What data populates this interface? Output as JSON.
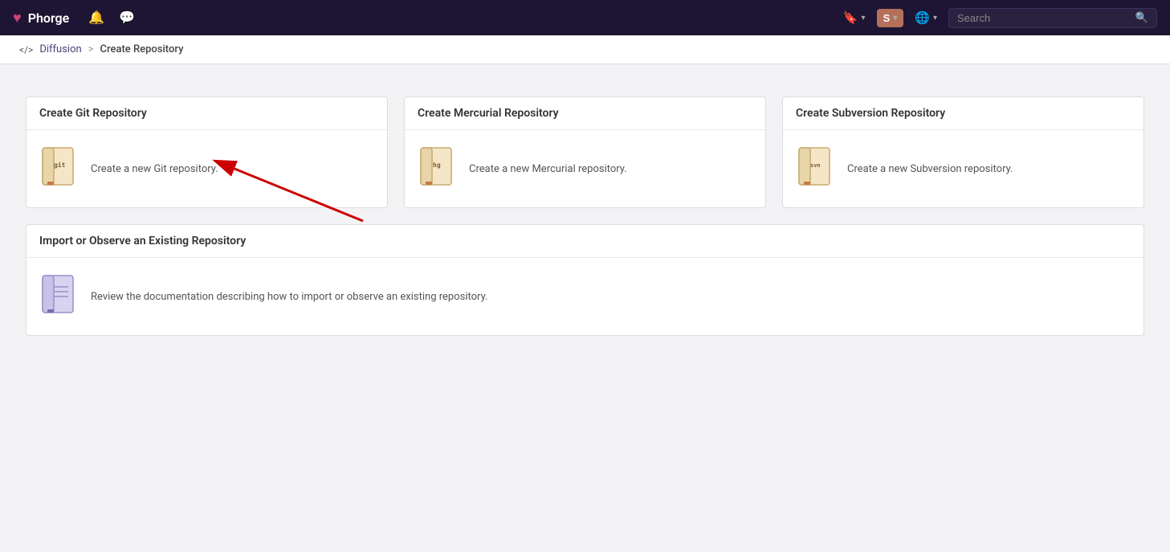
{
  "navbar": {
    "brand": "Phorge",
    "search_placeholder": "Search",
    "bookmark_label": "Bookmark",
    "avatar_label": "S",
    "globe_label": "Language"
  },
  "breadcrumb": {
    "parent_icon": "</>",
    "parent_label": "Diffusion",
    "separator": ">",
    "current": "Create Repository"
  },
  "git_card": {
    "header": "Create Git Repository",
    "link_text": "Create a new Git repository."
  },
  "mercurial_card": {
    "header": "Create Mercurial Repository",
    "link_text": "Create a new Mercurial repository."
  },
  "subversion_card": {
    "header": "Create Subversion Repository",
    "link_text": "Create a new Subversion repository."
  },
  "import_card": {
    "header": "Import or Observe an Existing Repository",
    "link_text": "Review the documentation describing how to import or observe an existing repository."
  }
}
